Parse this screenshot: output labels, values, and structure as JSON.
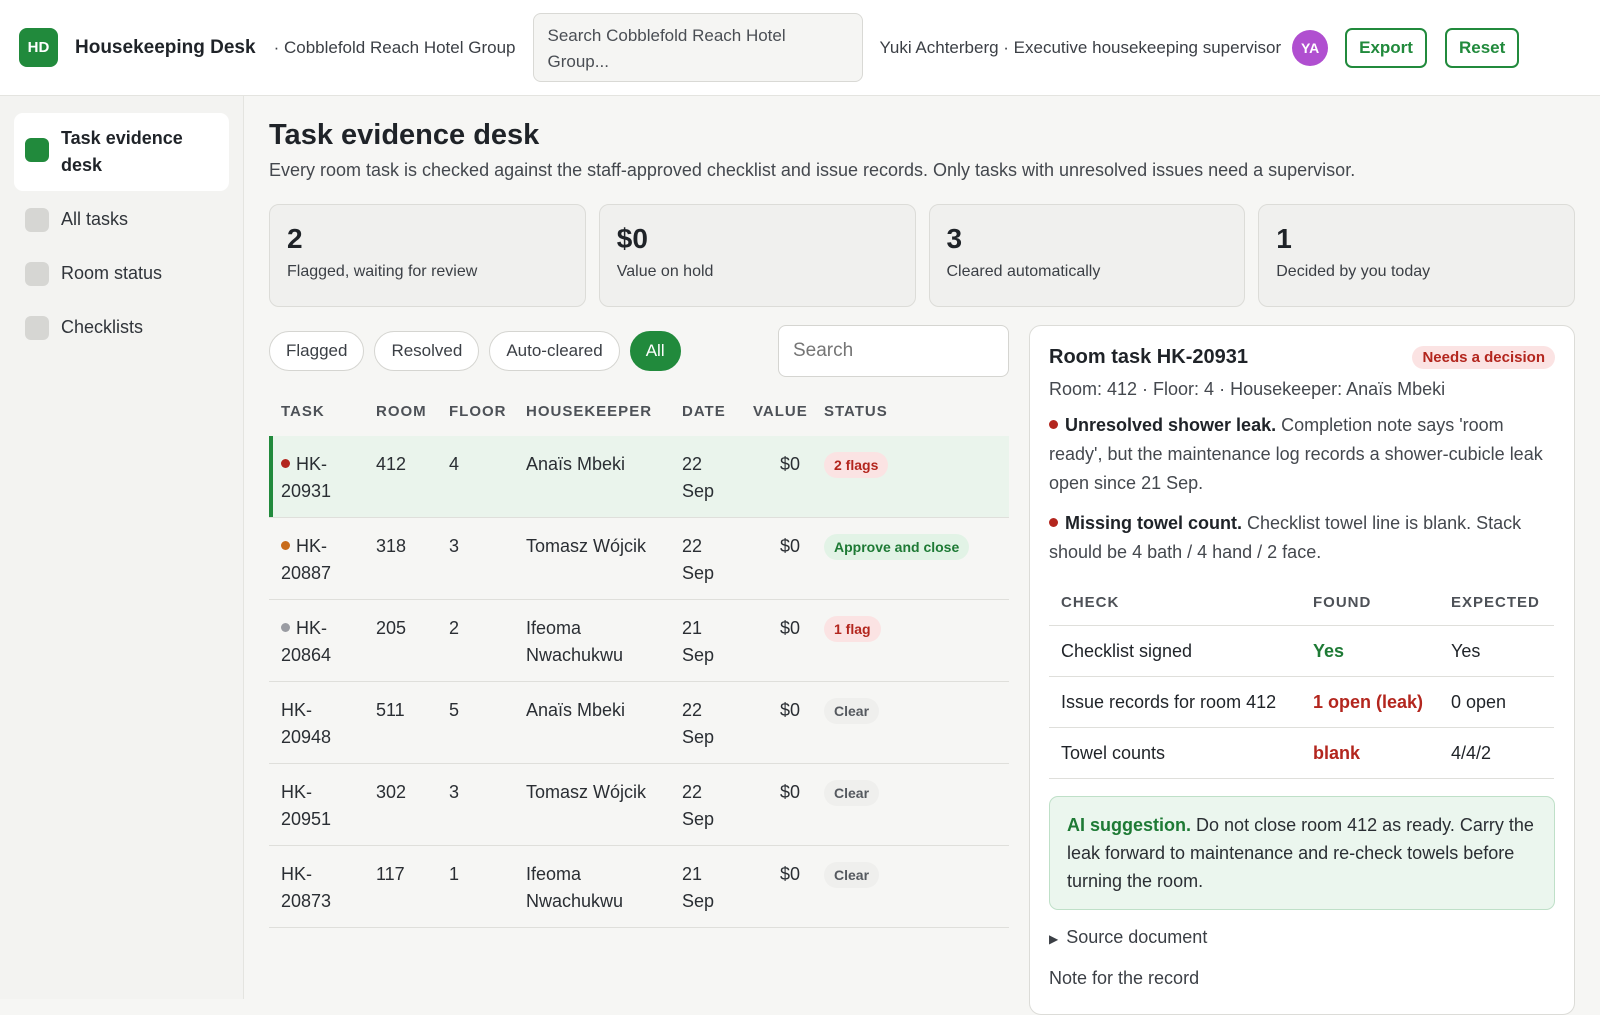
{
  "header": {
    "logo": "HD",
    "app_title": "Housekeeping Desk",
    "org": "· Cobblefold Reach Hotel Group",
    "search_placeholder": "Search Cobblefold Reach Hotel Group...",
    "user": "Yuki Achterberg · Executive housekeeping supervisor",
    "avatar": "YA",
    "export_label": "Export",
    "reset_label": "Reset"
  },
  "sidebar": {
    "items": [
      {
        "label": "Task evidence desk",
        "active": true
      },
      {
        "label": "All tasks",
        "active": false
      },
      {
        "label": "Room status",
        "active": false
      },
      {
        "label": "Checklists",
        "active": false
      }
    ]
  },
  "page": {
    "title": "Task evidence desk",
    "subtitle": "Every room task is checked against the staff-approved checklist and issue records. Only tasks with unresolved issues need a supervisor."
  },
  "stats": [
    {
      "value": "2",
      "label": "Flagged, waiting for review"
    },
    {
      "value": "$0",
      "label": "Value on hold"
    },
    {
      "value": "3",
      "label": "Cleared automatically"
    },
    {
      "value": "1",
      "label": "Decided by you today"
    }
  ],
  "filters": {
    "chips": [
      "Flagged",
      "Resolved",
      "Auto-cleared",
      "All"
    ],
    "active": "All",
    "search_placeholder": "Search"
  },
  "table": {
    "columns": [
      "TASK",
      "ROOM",
      "FLOOR",
      "HOUSEKEEPER",
      "DATE",
      "VALUE",
      "STATUS"
    ],
    "rows": [
      {
        "task": "HK-20931",
        "task_l1": "HK-",
        "task_l2": "20931",
        "dot": "#b3261e",
        "room": "412",
        "floor": "4",
        "housekeeper": "Anaïs Mbeki",
        "date_l1": "22",
        "date_l2": "Sep",
        "value": "$0",
        "status": "2 flags",
        "status_kind": "red",
        "selected": true
      },
      {
        "task": "HK-20887",
        "task_l1": "HK-",
        "task_l2": "20887",
        "dot": "#c86b1a",
        "room": "318",
        "floor": "3",
        "housekeeper": "Tomasz Wójcik",
        "date_l1": "22",
        "date_l2": "Sep",
        "value": "$0",
        "status": "Approve and close",
        "status_kind": "green",
        "selected": false
      },
      {
        "task": "HK-20864",
        "task_l1": "HK-",
        "task_l2": "20864",
        "dot": "#9a9ca2",
        "room": "205",
        "floor": "2",
        "housekeeper": "Ifeoma Nwachukwu",
        "date_l1": "21",
        "date_l2": "Sep",
        "value": "$0",
        "status": "1 flag",
        "status_kind": "red",
        "selected": false
      },
      {
        "task": "HK-20948",
        "task_l1": "HK-",
        "task_l2": "20948",
        "dot": "",
        "room": "511",
        "floor": "5",
        "housekeeper": "Anaïs Mbeki",
        "date_l1": "22",
        "date_l2": "Sep",
        "value": "$0",
        "status": "Clear",
        "status_kind": "grey",
        "selected": false
      },
      {
        "task": "HK-20951",
        "task_l1": "HK-",
        "task_l2": "20951",
        "dot": "",
        "room": "302",
        "floor": "3",
        "housekeeper": "Tomasz Wójcik",
        "date_l1": "22",
        "date_l2": "Sep",
        "value": "$0",
        "status": "Clear",
        "status_kind": "grey",
        "selected": false
      },
      {
        "task": "HK-20873",
        "task_l1": "HK-",
        "task_l2": "20873",
        "dot": "",
        "room": "117",
        "floor": "1",
        "housekeeper": "Ifeoma Nwachukwu",
        "date_l1": "21",
        "date_l2": "Sep",
        "value": "$0",
        "status": "Clear",
        "status_kind": "grey",
        "selected": false
      }
    ]
  },
  "detail": {
    "title": "Room task HK-20931",
    "badge": "Needs a decision",
    "meta": "Room: 412 · Floor: 4 · Housekeeper: Anaïs Mbeki",
    "issues": [
      {
        "headline": "Unresolved shower leak.",
        "text": "Completion note says 'room ready', but the maintenance log records a shower-cubicle leak open since 21 Sep."
      },
      {
        "headline": "Missing towel count.",
        "text": "Checklist towel line is blank. Stack should be 4 bath / 4 hand / 2 face."
      }
    ],
    "checks_columns": [
      "CHECK",
      "FOUND",
      "EXPECTED"
    ],
    "checks": [
      {
        "check": "Checklist signed",
        "found": "Yes",
        "found_ok": true,
        "expected": "Yes"
      },
      {
        "check": "Issue records for room 412",
        "found": "1 open (leak)",
        "found_ok": false,
        "expected": "0 open"
      },
      {
        "check": "Towel counts",
        "found": "blank",
        "found_ok": false,
        "expected": "4/4/2"
      }
    ],
    "ai_label": "AI suggestion.",
    "ai_text": "Do not close room 412 as ready. Carry the leak forward to maintenance and re-check towels before turning the room.",
    "source_label": "Source document",
    "note_label": "Note for the record"
  },
  "colors": {
    "accent": "#218a3c",
    "danger": "#b3261e",
    "avatar": "#b04fd0"
  }
}
